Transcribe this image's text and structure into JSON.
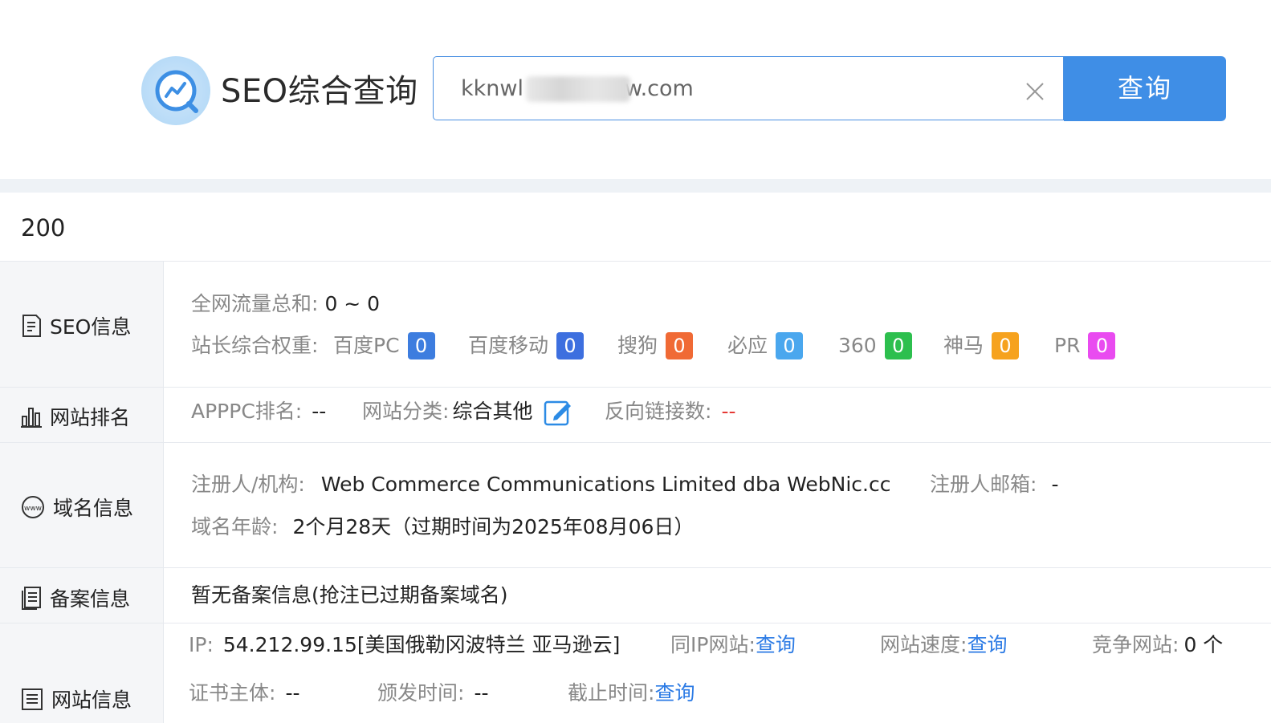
{
  "header": {
    "title": "SEO综合查询",
    "search_value": "kknwl.  .kgewgew.com",
    "search_display": "kknwl",
    "search_display_tail": "w.com",
    "search_button": "查询"
  },
  "status_code": "200",
  "sections": {
    "seo": {
      "label": "SEO信息",
      "traffic_label": "全网流量总和:",
      "traffic_value": "0 ~ 0",
      "weight_label": "站长综合权重:",
      "weights": [
        {
          "name": "百度PC",
          "value": "0",
          "color": "#3d7ddf"
        },
        {
          "name": "百度移动",
          "value": "0",
          "color": "#3d6fdf"
        },
        {
          "name": "搜狗",
          "value": "0",
          "color": "#f06a35"
        },
        {
          "name": "必应",
          "value": "0",
          "color": "#4aa7ee"
        },
        {
          "name": "360",
          "value": "0",
          "color": "#2dbf4e"
        },
        {
          "name": "神马",
          "value": "0",
          "color": "#f6a21e"
        },
        {
          "name": "PR",
          "value": "0",
          "color": "#e94bf0"
        }
      ]
    },
    "ranking": {
      "label": "网站排名",
      "apppc_label": "APPPC排名:",
      "apppc_value": "--",
      "category_label": "网站分类:",
      "category_value": "综合其他",
      "backlinks_label": "反向链接数:",
      "backlinks_value": "--"
    },
    "domain": {
      "label": "域名信息",
      "registrant_label": "注册人/机构:",
      "registrant_value": "Web Commerce Communications Limited dba WebNic.cc",
      "email_label": "注册人邮箱:",
      "email_value": "-",
      "age_label": "域名年龄:",
      "age_value": "2个月28天（过期时间为2025年08月06日）"
    },
    "icp": {
      "label": "备案信息",
      "value": "暂无备案信息(抢注已过期备案域名)"
    },
    "site": {
      "label": "网站信息",
      "ip_label": "IP:",
      "ip_value": "54.212.99.15[美国俄勒冈波特兰 亚马逊云]",
      "same_ip_label": "同IP网站:",
      "same_ip_link": "查询",
      "speed_label": "网站速度:",
      "speed_link": "查询",
      "competitor_label": "竞争网站:",
      "competitor_value": "0 个",
      "cert_label": "证书主体:",
      "cert_value": "--",
      "issue_label": "颁发时间:",
      "issue_value": "--",
      "expire_label": "截止时间:",
      "expire_link": "查询"
    }
  }
}
